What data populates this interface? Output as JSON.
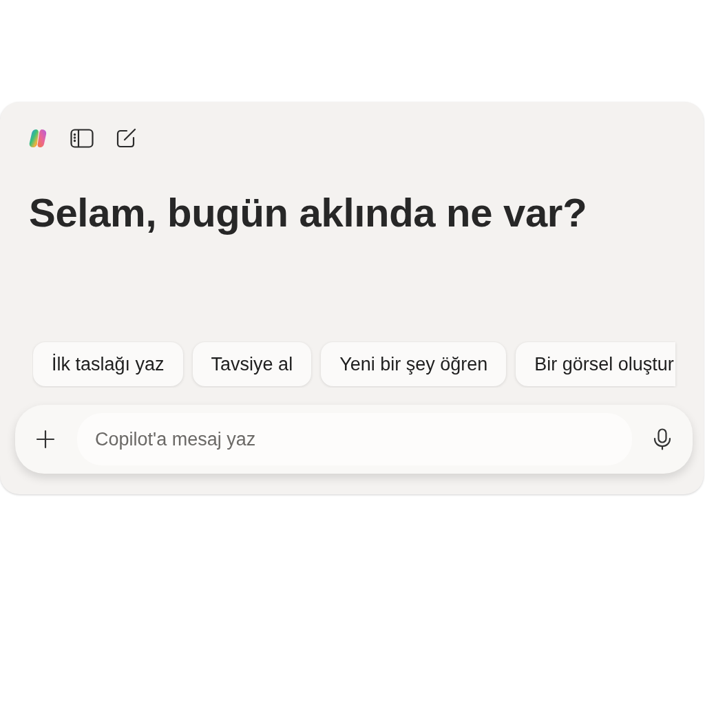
{
  "greeting": "Selam, bugün aklında ne var?",
  "suggestions": [
    {
      "label": "İlk taslağı yaz"
    },
    {
      "label": "Tavsiye al"
    },
    {
      "label": "Yeni bir şey öğren"
    },
    {
      "label": "Bir görsel oluştur"
    }
  ],
  "composer": {
    "placeholder": "Copilot'a mesaj yaz"
  }
}
